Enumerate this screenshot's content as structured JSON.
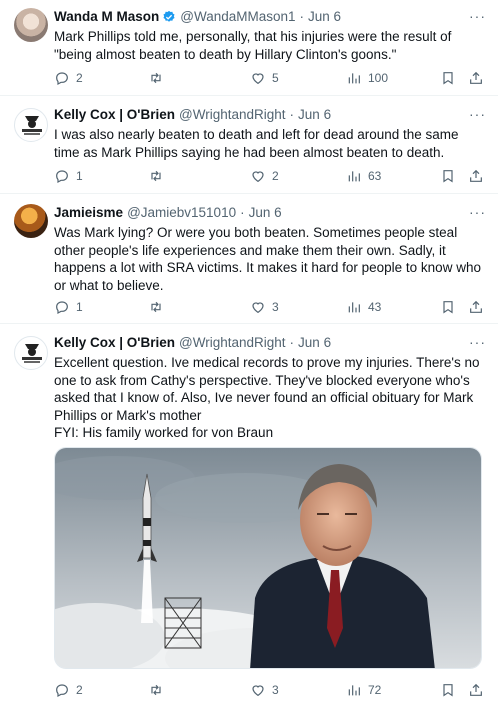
{
  "tweets": [
    {
      "name": "Wanda M Mason",
      "handle": "@WandaMMason1",
      "dot": "·",
      "date": "Jun 6",
      "verified": true,
      "text": "Mark Phillips told me, personally, that his injuries were the result of \"being almost beaten to death by Hillary Clinton's goons.\"",
      "replies": "2",
      "retweets": "",
      "likes": "5",
      "views": "100"
    },
    {
      "name": "Kelly Cox | O'Brien",
      "handle": "@WrightandRight",
      "dot": "·",
      "date": "Jun 6",
      "text": "I was also nearly beaten to death and left for dead around the same time as Mark Phillips saying he had been almost beaten to death.",
      "replies": "1",
      "retweets": "",
      "likes": "2",
      "views": "63"
    },
    {
      "name": "Jamieisme",
      "handle": "@Jamiebv151010",
      "dot": "·",
      "date": "Jun 6",
      "text": "Was Mark lying? Or were you both beaten. Sometimes people steal other people's life experiences and make them their own. Sadly, it happens a lot with SRA victims. It makes it hard for people to know who or what to believe.",
      "replies": "1",
      "retweets": "",
      "likes": "3",
      "views": "43"
    },
    {
      "name": "Kelly Cox | O'Brien",
      "handle": "@WrightandRight",
      "dot": "·",
      "date": "Jun 6",
      "text": "Excellent question. Ive medical records to prove my injuries. There's no one to ask from Cathy's perspective. They've blocked everyone who's asked that I know of. Also, Ive never found an official obituary for Mark Phillips or Mark's mother\nFYI: His family worked for von Braun",
      "replies": "2",
      "retweets": "",
      "likes": "3",
      "views": "72"
    }
  ],
  "more_glyph": "···",
  "colors": {
    "text": "#0f1419",
    "muted": "#536471",
    "verified": "#1d9bf0",
    "divider": "#eff3f4"
  }
}
